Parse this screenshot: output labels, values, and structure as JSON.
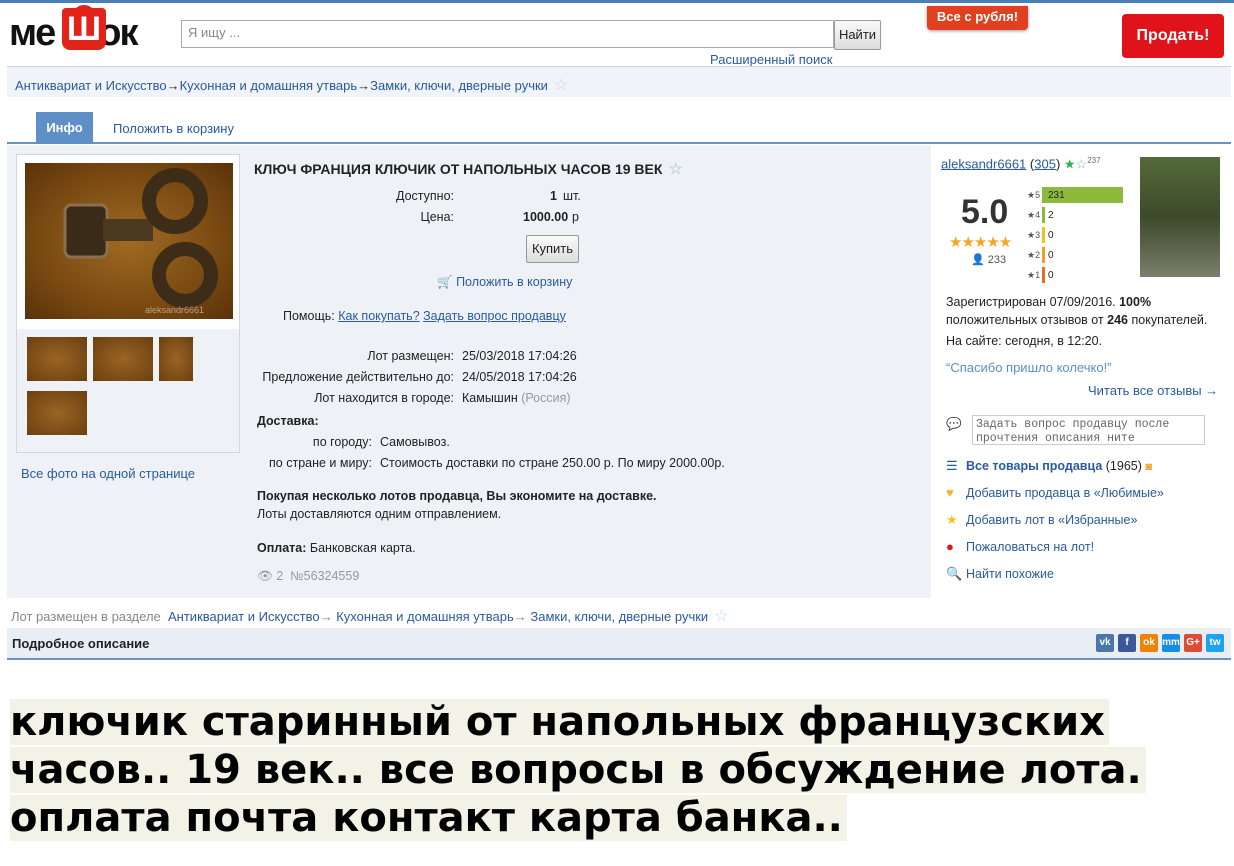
{
  "header": {
    "logo_text": "мешок",
    "search_placeholder": "Я ищу ...",
    "search_button": "Найти",
    "advanced_search": "Расширенный поиск",
    "promo": "Все с рубля!",
    "sell_button": "Продать!"
  },
  "breadcrumb": [
    "Антиквариат и Искусство",
    "Кухонная и домашняя утварь",
    "Замки, ключи, дверные ручки"
  ],
  "tabs": {
    "info": "Инфо",
    "add_to_cart": "Положить в корзину"
  },
  "lot": {
    "title": "КЛЮЧ ФРАНЦИЯ КЛЮЧИК ОТ НАПОЛЬНЫХ ЧАСОВ 19 ВЕК",
    "available_label": "Доступно:",
    "available_value": "1",
    "available_unit": "шт.",
    "price_label": "Цена:",
    "price_value": "1000.00",
    "price_unit": "р",
    "buy_button": "Купить",
    "cart_link": "Положить в корзину",
    "help_label": "Помощь:",
    "help_how": "Как покупать?",
    "help_ask": "Задать вопрос продавцу",
    "posted_label": "Лот размещен:",
    "posted_value": "25/03/2018 17:04:26",
    "valid_label": "Предложение действительно до:",
    "valid_value": "24/05/2018 17:04:26",
    "city_label": "Лот находится в городе:",
    "city_value": "Камышин",
    "city_region": "(Россия)",
    "delivery_label": "Доставка:",
    "delivery_city_label": "по городу:",
    "delivery_city_value": "Самовывоз.",
    "delivery_world_label": "по стране и миру:",
    "delivery_world_value": "Стоимость доставки по стране 250.00 р. По миру 2000.00р.",
    "save_bold": "Покупая несколько лотов продавца, Вы экономите на доставке.",
    "save_note": "Лоты доставляются одним отправлением.",
    "payment_label": "Оплата:",
    "payment_value": "Банковская карта.",
    "views": "2",
    "lot_number": "№56324559",
    "all_photos": "Все фото на одной странице",
    "watermark": "aleksandr6661"
  },
  "seller": {
    "name": "aleksandr6661",
    "rating_count": "305",
    "fav_count": "237",
    "score": "5.0",
    "reviews": "233",
    "bars": [
      {
        "stars": "5",
        "count": "231",
        "color": "#8dba3c",
        "fraction": 0.99
      },
      {
        "stars": "4",
        "count": "2",
        "color": "#8dba3c",
        "fraction": 0.02
      },
      {
        "stars": "3",
        "count": "0",
        "color": "#f0c020",
        "fraction": 0.02
      },
      {
        "stars": "2",
        "count": "0",
        "color": "#f0a020",
        "fraction": 0.02
      },
      {
        "stars": "1",
        "count": "0",
        "color": "#e86a2a",
        "fraction": 0.02
      }
    ],
    "registered": "Зарегистрирован 07/09/2016.",
    "positive_pct": "100%",
    "positive_text": "положительных отзывов от",
    "buyers": "246",
    "buyers_text": "покупателей.",
    "online": "На сайте: сегодня, в 12:20.",
    "quote": "“Спасибо пришло колечко!”",
    "read_all": "Читать все отзывы →",
    "ask_placeholder": "Задать вопрос продавцу после прочтения описания ните",
    "all_goods": "Все товары продавца",
    "all_goods_count": "(1965)",
    "add_fav": "Добавить продавца в «Любимые»",
    "add_lot": "Добавить лот в «Избранные»",
    "complain": "Пожаловаться на лот!",
    "similar": "Найти похожие"
  },
  "footer": {
    "placed_in": "Лот размещен в разделе",
    "desc_title": "Подробное описание",
    "social": [
      "vk",
      "f",
      "ok",
      "mm",
      "G+",
      "tw"
    ],
    "social_colors": [
      "#4a76a8",
      "#3b5998",
      "#ee8208",
      "#168de2",
      "#dd4b39",
      "#1da1f2"
    ]
  },
  "description": [
    "ключик старинный от напольных французских",
    "часов.. 19 век.. все вопросы в обсуждение лота.",
    "оплата почта контакт карта банка.."
  ]
}
